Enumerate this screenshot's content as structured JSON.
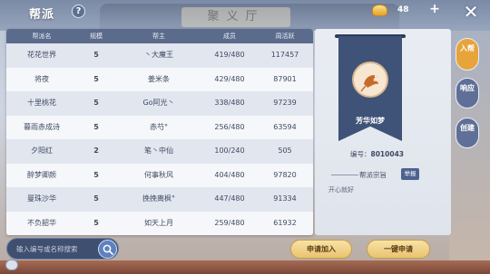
{
  "header": {
    "title": "帮派",
    "help_label": "?",
    "gold_amount": "48",
    "plus_label": "+",
    "close_label": "✕"
  },
  "background_sign": "聚义厅",
  "table": {
    "columns": [
      "帮派名",
      "规模",
      "帮主",
      "成员",
      "周活跃"
    ],
    "rows": [
      {
        "name": "花花世界",
        "scale": "5",
        "leader": "丶大魔王",
        "members": "419/480",
        "activity": "117457"
      },
      {
        "name": "将夜",
        "scale": "5",
        "leader": "姜米条",
        "members": "429/480",
        "activity": "87901"
      },
      {
        "name": "十里桃花",
        "scale": "5",
        "leader": "Go阿光丶",
        "members": "338/480",
        "activity": "97239"
      },
      {
        "name": "暮雨赤成诗",
        "scale": "5",
        "leader": "赤芍°",
        "members": "256/480",
        "activity": "63594"
      },
      {
        "name": "夕阳红",
        "scale": "2",
        "leader": "笔丶中仙",
        "members": "100/240",
        "activity": "505"
      },
      {
        "name": "醉梦卿颜",
        "scale": "5",
        "leader": "何事秋风",
        "members": "404/480",
        "activity": "97820"
      },
      {
        "name": "曼珠沙华",
        "scale": "5",
        "leader": "挽挽离枫°",
        "members": "447/480",
        "activity": "91334"
      },
      {
        "name": "不负韶华",
        "scale": "5",
        "leader": "如天上月",
        "members": "259/480",
        "activity": "61932"
      }
    ]
  },
  "search": {
    "placeholder": "输入编号或名称搜索"
  },
  "guild_info": {
    "name": "芳华如梦",
    "id_label": "编号：",
    "id_value": "8010043",
    "motto_label": "帮派宗旨",
    "report_label": "举报",
    "motto_text": "开心就好"
  },
  "buttons": {
    "apply": "申请加入",
    "quick_apply": "一键申请"
  },
  "side_tabs": {
    "join": "入帮",
    "respond": "响应",
    "create": "创建"
  },
  "colors": {
    "header_row": "#5b6b8c",
    "accent_gold": "#e9c46f",
    "banner": "#3f5277",
    "tab_active": "#e7a43a"
  }
}
